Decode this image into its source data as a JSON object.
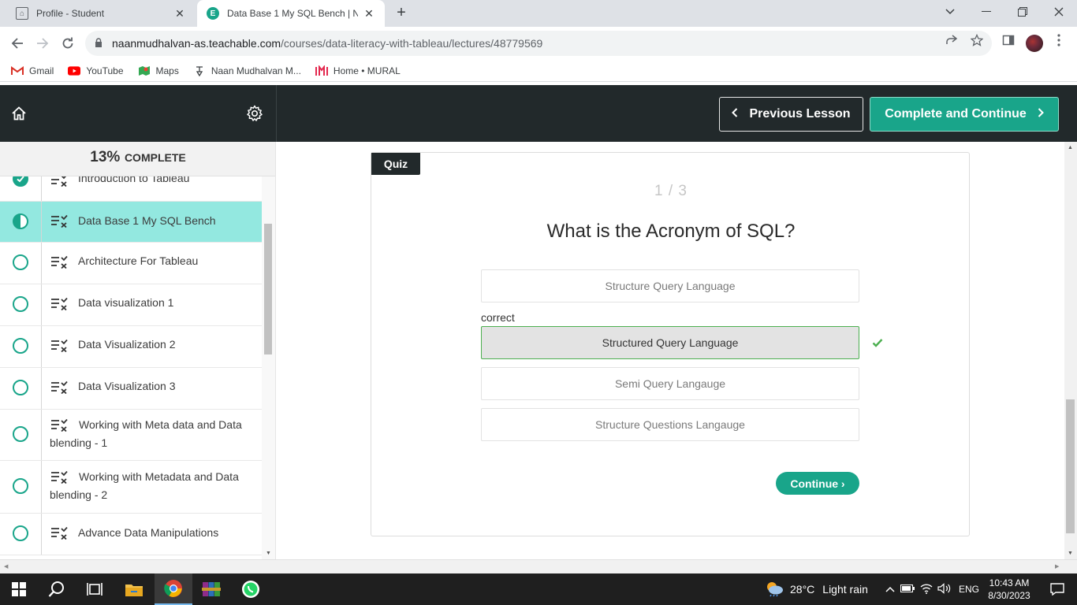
{
  "browser": {
    "tabs": [
      {
        "title": "Profile - Student",
        "active": false
      },
      {
        "title": "Data Base 1 My SQL Bench | Naa",
        "active": true
      }
    ],
    "url_host": "naanmudhalvan-as.teachable.com",
    "url_path": "/courses/data-literacy-with-tableau/lectures/48779569",
    "bookmarks": [
      {
        "label": "Gmail",
        "icon": "gmail-icon"
      },
      {
        "label": "YouTube",
        "icon": "youtube-icon"
      },
      {
        "label": "Maps",
        "icon": "maps-icon"
      },
      {
        "label": "Naan Mudhalvan M...",
        "icon": "naan-mudhalvan-icon"
      },
      {
        "label": "Home • MURAL",
        "icon": "mural-icon"
      }
    ]
  },
  "header": {
    "prev_label": "Previous Lesson",
    "next_label": "Complete and Continue"
  },
  "sidebar": {
    "progress_pct": "13%",
    "progress_label": "COMPLETE",
    "lessons": [
      {
        "title": "Introduction to Tableau",
        "status": "done"
      },
      {
        "title": "Data Base 1 My SQL Bench",
        "status": "in-progress"
      },
      {
        "title": "Architecture For Tableau",
        "status": "todo"
      },
      {
        "title": "Data visualization 1",
        "status": "todo"
      },
      {
        "title": "Data Visualization 2",
        "status": "todo"
      },
      {
        "title": "Data Visualization 3",
        "status": "todo"
      },
      {
        "title": "Working with Meta data and Data blending - 1",
        "status": "todo"
      },
      {
        "title": "Working with Metadata and Data blending - 2",
        "status": "todo"
      },
      {
        "title": "Advance Data Manipulations",
        "status": "todo"
      }
    ]
  },
  "quiz": {
    "badge": "Quiz",
    "counter": "1 / 3",
    "question": "What is the Acronym of SQL?",
    "correct_label": "correct",
    "answers": [
      {
        "text": "Structure Query Language",
        "correct": false
      },
      {
        "text": "Structured Query Language",
        "correct": true
      },
      {
        "text": "Semi Query Langauge",
        "correct": false
      },
      {
        "text": "Structure Questions Langauge",
        "correct": false
      }
    ],
    "continue_label": "Continue ›"
  },
  "taskbar": {
    "temperature": "28°C",
    "weather": "Light rain",
    "language": "ENG",
    "time": "10:43 AM",
    "date": "8/30/2023"
  },
  "colors": {
    "accent": "#19a58a",
    "header_bg": "#22292b",
    "current_lesson_bg": "#93e8e0"
  }
}
